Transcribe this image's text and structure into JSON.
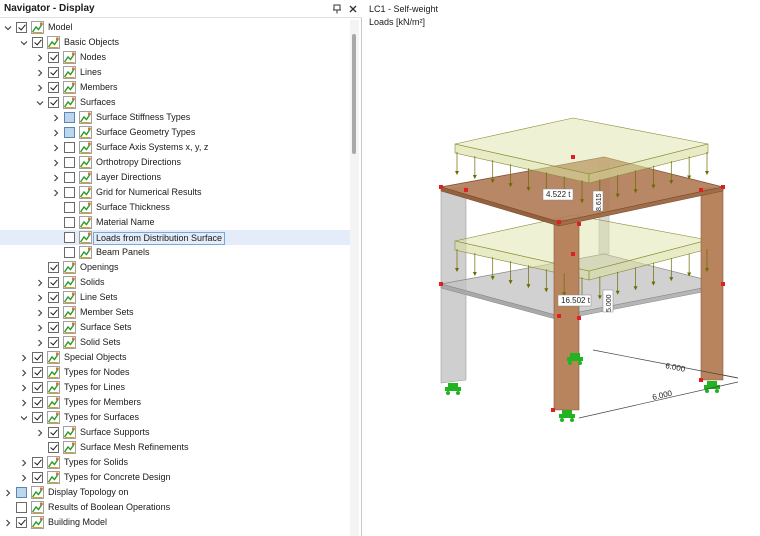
{
  "navigator": {
    "title": "Navigator - Display",
    "items": [
      {
        "label": "Model",
        "level": 0,
        "expand": "open",
        "check": "on"
      },
      {
        "label": "Basic Objects",
        "level": 1,
        "expand": "open",
        "check": "on"
      },
      {
        "label": "Nodes",
        "level": 2,
        "expand": "closed",
        "check": "on"
      },
      {
        "label": "Lines",
        "level": 2,
        "expand": "closed",
        "check": "on"
      },
      {
        "label": "Members",
        "level": 2,
        "expand": "closed",
        "check": "on"
      },
      {
        "label": "Surfaces",
        "level": 2,
        "expand": "open",
        "check": "on"
      },
      {
        "label": "Surface Stiffness Types",
        "level": 3,
        "expand": "closed",
        "check": "partial"
      },
      {
        "label": "Surface Geometry Types",
        "level": 3,
        "expand": "closed",
        "check": "partial"
      },
      {
        "label": "Surface Axis Systems x, y, z",
        "level": 3,
        "expand": "closed",
        "check": "off"
      },
      {
        "label": "Orthotropy Directions",
        "level": 3,
        "expand": "closed",
        "check": "off"
      },
      {
        "label": "Layer Directions",
        "level": 3,
        "expand": "closed",
        "check": "off"
      },
      {
        "label": "Grid for Numerical Results",
        "level": 3,
        "expand": "closed",
        "check": "off"
      },
      {
        "label": "Surface Thickness",
        "level": 3,
        "expand": "none",
        "check": "off"
      },
      {
        "label": "Material Name",
        "level": 3,
        "expand": "none",
        "check": "off"
      },
      {
        "label": "Loads from Distribution Surface",
        "level": 3,
        "expand": "none",
        "check": "off",
        "selected": true
      },
      {
        "label": "Beam Panels",
        "level": 3,
        "expand": "none",
        "check": "off"
      },
      {
        "label": "Openings",
        "level": 2,
        "expand": "none",
        "check": "on"
      },
      {
        "label": "Solids",
        "level": 2,
        "expand": "closed",
        "check": "on"
      },
      {
        "label": "Line Sets",
        "level": 2,
        "expand": "closed",
        "check": "on"
      },
      {
        "label": "Member Sets",
        "level": 2,
        "expand": "closed",
        "check": "on"
      },
      {
        "label": "Surface Sets",
        "level": 2,
        "expand": "closed",
        "check": "on"
      },
      {
        "label": "Solid Sets",
        "level": 2,
        "expand": "closed",
        "check": "on"
      },
      {
        "label": "Special Objects",
        "level": 1,
        "expand": "closed",
        "check": "on"
      },
      {
        "label": "Types for Nodes",
        "level": 1,
        "expand": "closed",
        "check": "on"
      },
      {
        "label": "Types for Lines",
        "level": 1,
        "expand": "closed",
        "check": "on"
      },
      {
        "label": "Types for Members",
        "level": 1,
        "expand": "closed",
        "check": "on"
      },
      {
        "label": "Types for Surfaces",
        "level": 1,
        "expand": "open",
        "check": "on"
      },
      {
        "label": "Surface Supports",
        "level": 2,
        "expand": "closed",
        "check": "on"
      },
      {
        "label": "Surface Mesh Refinements",
        "level": 2,
        "expand": "none",
        "check": "on"
      },
      {
        "label": "Types for Solids",
        "level": 1,
        "expand": "closed",
        "check": "on"
      },
      {
        "label": "Types for Concrete Design",
        "level": 1,
        "expand": "closed",
        "check": "on"
      },
      {
        "label": "Display Topology on",
        "level": 0,
        "expand": "closed",
        "check": "partial"
      },
      {
        "label": "Results of Boolean Operations",
        "level": 0,
        "expand": "none",
        "check": "off"
      },
      {
        "label": "Building Model",
        "level": 0,
        "expand": "closed",
        "check": "on"
      }
    ]
  },
  "viewport": {
    "line1": "LC1 - Self-weight",
    "line2": "Loads [kN/m²]",
    "annotations": {
      "load_upper": "4.522 t",
      "load_lower": "16.502 t",
      "value_upper_vertical": "8.615",
      "value_lower_vertical": "5.000",
      "dim_back": "6.000",
      "dim_front": "6.000"
    }
  },
  "colors": {
    "load_fill": "#d9dfa0",
    "load_arrow": "#6b6b00",
    "slab_upper": "#b07a55",
    "slab_lower": "#c2c2c2",
    "column_brown": "#b8845e",
    "column_gray": "#cfcfcf",
    "node_red": "#e02020",
    "support_green": "#21b321",
    "selection": "#e3ecf8"
  },
  "icons": {
    "pin": "pin-icon",
    "close": "close-icon",
    "display_item": "display-item-icon"
  }
}
